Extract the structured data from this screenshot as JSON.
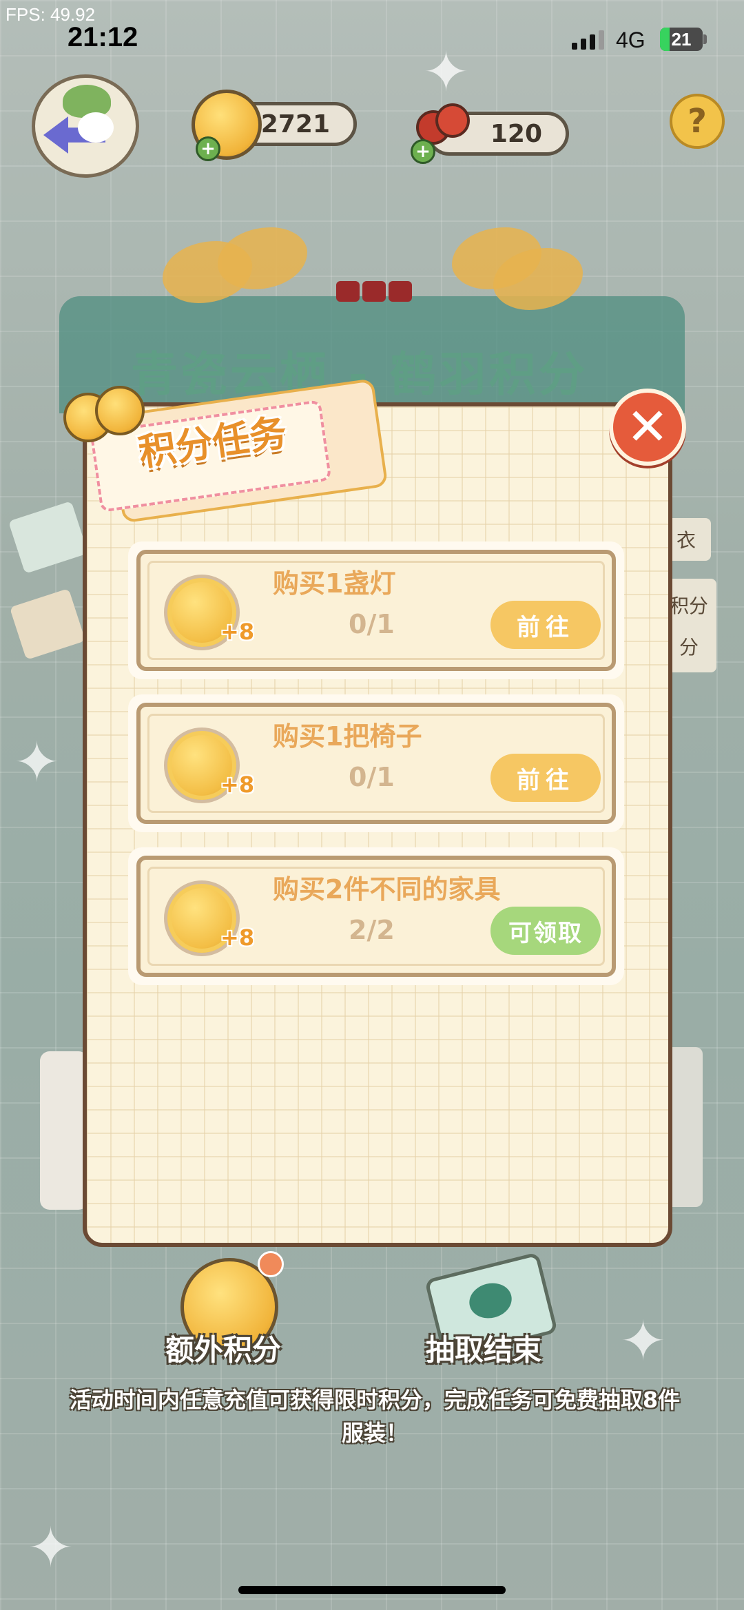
{
  "status_bar": {
    "fps": "FPS: 49.92",
    "time": "21:12",
    "network": "4G",
    "battery": "21"
  },
  "hud": {
    "coins": "2721",
    "cherries": "120",
    "help_label": "?"
  },
  "banner": {
    "title": "青瓷云栖 - 鹤羽积分"
  },
  "modal": {
    "title": "积分任务",
    "close_label": "✕",
    "tasks": [
      {
        "name": "购买1盏灯",
        "progress": "0/1",
        "reward": "+8",
        "button": "前往",
        "state": "go"
      },
      {
        "name": "购买1把椅子",
        "progress": "0/1",
        "reward": "+8",
        "button": "前往",
        "state": "go"
      },
      {
        "name": "购买2件不同的家具",
        "progress": "2/2",
        "reward": "+8",
        "button": "可领取",
        "state": "claim"
      }
    ]
  },
  "side_tabs": {
    "tab1": "衣",
    "tab2a": "积分",
    "tab2b": "分"
  },
  "bottom": {
    "extra_points_label": "额外积分",
    "draw_end_label": "抽取结束",
    "notice": "活动时间内任意充值可获得限时积分，完成任务可免费抽取8件服装！"
  },
  "colors": {
    "go_button": "#f6c763",
    "claim_button": "#a6d77c",
    "close_button": "#e55b3b",
    "modal_bg": "#fbf3dc"
  }
}
